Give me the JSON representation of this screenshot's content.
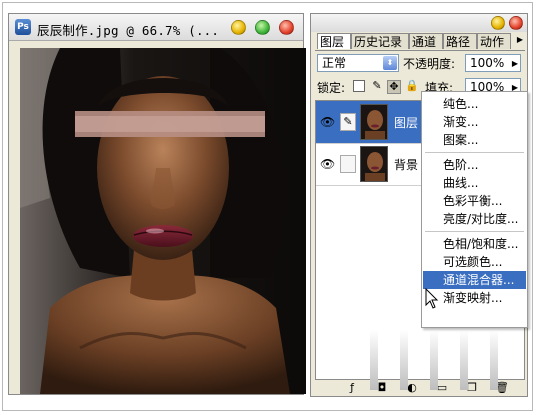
{
  "document": {
    "title": "辰辰制作.jpg @ 66.7% (..."
  },
  "palette": {
    "tabs": [
      "图层",
      "历史记录",
      "通道",
      "路径",
      "动作"
    ],
    "blend_mode": "正常",
    "opacity_label": "不透明度:",
    "opacity_value": "100%",
    "lock_label": "锁定:",
    "fill_label": "填充:",
    "fill_value": "100%",
    "layers": [
      {
        "name": "图层"
      },
      {
        "name": "背景"
      }
    ]
  },
  "menu": {
    "items": [
      "纯色...",
      "渐变...",
      "图案...",
      "色阶...",
      "曲线...",
      "色彩平衡...",
      "亮度/对比度...",
      "色相/饱和度...",
      "可选颜色...",
      "通道混合器...",
      "渐变映射..."
    ],
    "highlighted": "通道混合器..."
  },
  "colors": {
    "selection": "#3a6ec0",
    "window_bg": "#ece9d8"
  }
}
